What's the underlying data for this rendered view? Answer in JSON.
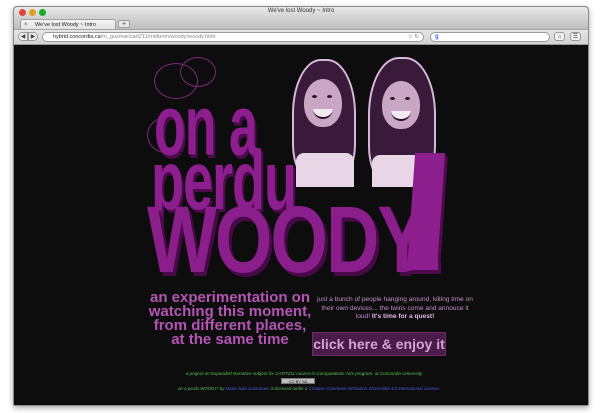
{
  "browser": {
    "window_title": "We've lost Woody ~ Intro",
    "tab_label": "We've lost Woody ~ Intro",
    "new_tab_glyph": "+",
    "url_host": "hybrid.concordia.ca",
    "url_path": "/m_gusmar/cart211/midterm/woody/woody.html",
    "icons": [
      "back-arrow-icon",
      "forward-arrow-icon",
      "bookmark-star-icon",
      "google-search-icon",
      "home-icon",
      "page-menu-icon"
    ]
  },
  "page": {
    "title_line1": "on a",
    "title_line2": "perdu",
    "title_line3": "WOODY",
    "tagline": "an experimentation on watching this moment, from different places, at the same time",
    "description_text": "just a bunch of people hanging around, killing time on their own devices... the twins come and annouce it loud! ",
    "description_bold": "It's time for a quest!",
    "enter_button": "click here & enjoy it",
    "credit_line": "a project on Expanded Narrative subject for CART211 course in Computations Arts program, at Concordia University",
    "license_badge": "CC BY SA",
    "license_work": "on a perdu WOODY!",
    "license_by": "by",
    "license_author": "Maria Julia Guimaraes",
    "license_text": "is licensed under a",
    "license_link": "Creative Commons Attribution-ShareAlike 4.0 International License."
  },
  "colors": {
    "page_bg": "#0d0d0d",
    "title_purple": "#8d1e8d",
    "tagline_purple": "#b455b4",
    "credit_green": "#57c757"
  }
}
